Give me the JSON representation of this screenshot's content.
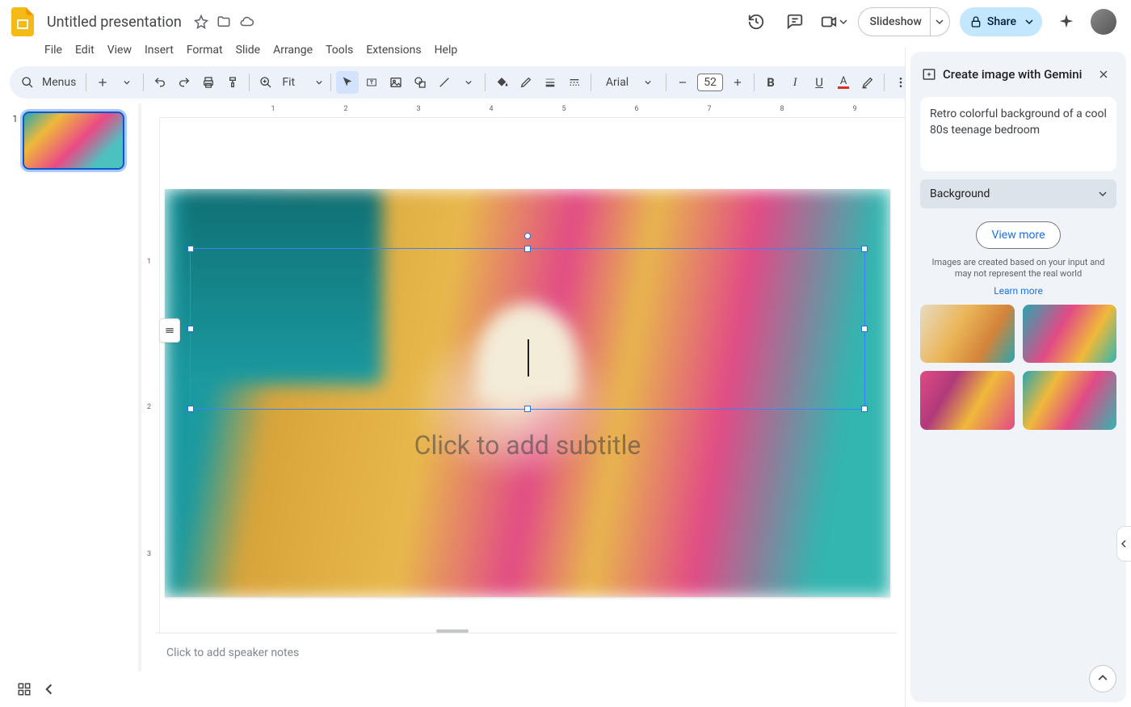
{
  "doc": {
    "title": "Untitled presentation"
  },
  "menu": {
    "items": [
      "File",
      "Edit",
      "View",
      "Insert",
      "Format",
      "Slide",
      "Arrange",
      "Tools",
      "Extensions",
      "Help"
    ]
  },
  "toolbar": {
    "menus_label": "Menus",
    "zoom": "Fit",
    "font": "Arial",
    "font_size": "52"
  },
  "header": {
    "slideshow": "Slideshow",
    "share": "Share"
  },
  "slide": {
    "number": "1",
    "subtitle_placeholder": "Click to add subtitle"
  },
  "notes": {
    "placeholder": "Click to add speaker notes"
  },
  "ruler_h": [
    "1",
    "2",
    "3",
    "4",
    "5",
    "6",
    "7",
    "8",
    "9"
  ],
  "ruler_v": [
    "1",
    "2",
    "3"
  ],
  "gemini": {
    "title": "Create image with Gemini",
    "prompt": "Retro colorful background of a cool 80s teenage bedroom",
    "select_label": "Background",
    "view_more": "View more",
    "disclaimer": "Images are created based on your input and may not represent the real world",
    "learn_more": "Learn more"
  }
}
